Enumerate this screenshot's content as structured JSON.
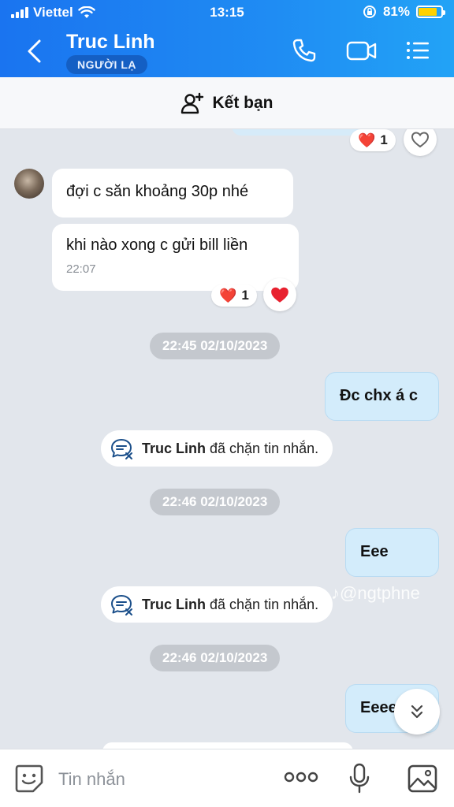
{
  "status_bar": {
    "carrier": "Viettel",
    "time": "13:15",
    "battery": "81%",
    "battery_level": 0.81
  },
  "header": {
    "contact_name": "Truc Linh",
    "badge": "NGƯỜI LẠ"
  },
  "add_friend": {
    "label": "Kết bạn"
  },
  "reactions": [
    {
      "emoji": "❤️",
      "count": "1"
    },
    {
      "emoji": "❤️",
      "count": "1"
    }
  ],
  "messages": [
    {
      "direction": "received",
      "text": "đợi c săn khoảng 30p nhé"
    },
    {
      "direction": "received",
      "text": "khi nào xong c gửi bill liền",
      "time": "22:07"
    },
    {
      "type": "timestamp",
      "text": "22:45 02/10/2023"
    },
    {
      "direction": "sent",
      "text": "Đc chx á c"
    },
    {
      "type": "system",
      "name": "Truc Linh",
      "text": "đã chặn tin nhắn."
    },
    {
      "type": "timestamp",
      "text": "22:46 02/10/2023"
    },
    {
      "direction": "sent",
      "text": "Eee"
    },
    {
      "type": "system",
      "name": "Truc Linh",
      "text": "đã chặn tin nhắn."
    },
    {
      "type": "timestamp",
      "text": "22:46 02/10/2023"
    },
    {
      "direction": "sent",
      "text": "Eeee"
    }
  ],
  "watermark": "@ngtphne",
  "composer": {
    "placeholder": "Tin nhắn"
  },
  "colors": {
    "header_blue": "#1f8cf3",
    "sent_bubble": "#d3ecfb",
    "heart": "#e8212f"
  }
}
